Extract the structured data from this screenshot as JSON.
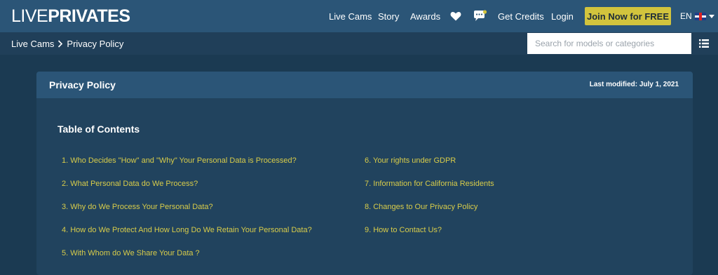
{
  "header": {
    "logo_light": "LIVE",
    "logo_bold": "PRIVATES",
    "nav": {
      "live_cams": "Live Cams",
      "story": "Story",
      "awards": "Awards",
      "get_credits": "Get Credits",
      "login": "Login"
    },
    "join_label": "Join Now for FREE",
    "lang": "EN"
  },
  "subbar": {
    "breadcrumb": [
      "Live Cams",
      "Privacy Policy"
    ],
    "search_placeholder": "Search for models or categories"
  },
  "card": {
    "title": "Privacy Policy",
    "modified": "Last modified: July 1, 2021",
    "toc_title": "Table of Contents",
    "toc_left": [
      "1. Who Decides \"How\" and \"Why\" Your Personal Data is Processed?",
      "2. What Personal Data do We Process?",
      "3. Why do We Process Your Personal Data?",
      "4. How do We Protect And How Long Do We Retain Your Personal Data?",
      "5. With Whom do We Share Your Data ?"
    ],
    "toc_right": [
      "6. Your rights under GDPR",
      "7. Information for California Residents",
      "8. Changes to Our Privacy Policy",
      "9. How to Contact Us?"
    ]
  },
  "colors": {
    "background": "#1b3a52",
    "topbar": "#2b5577",
    "accent": "#d2c43d",
    "link": "#d8cc4a"
  }
}
